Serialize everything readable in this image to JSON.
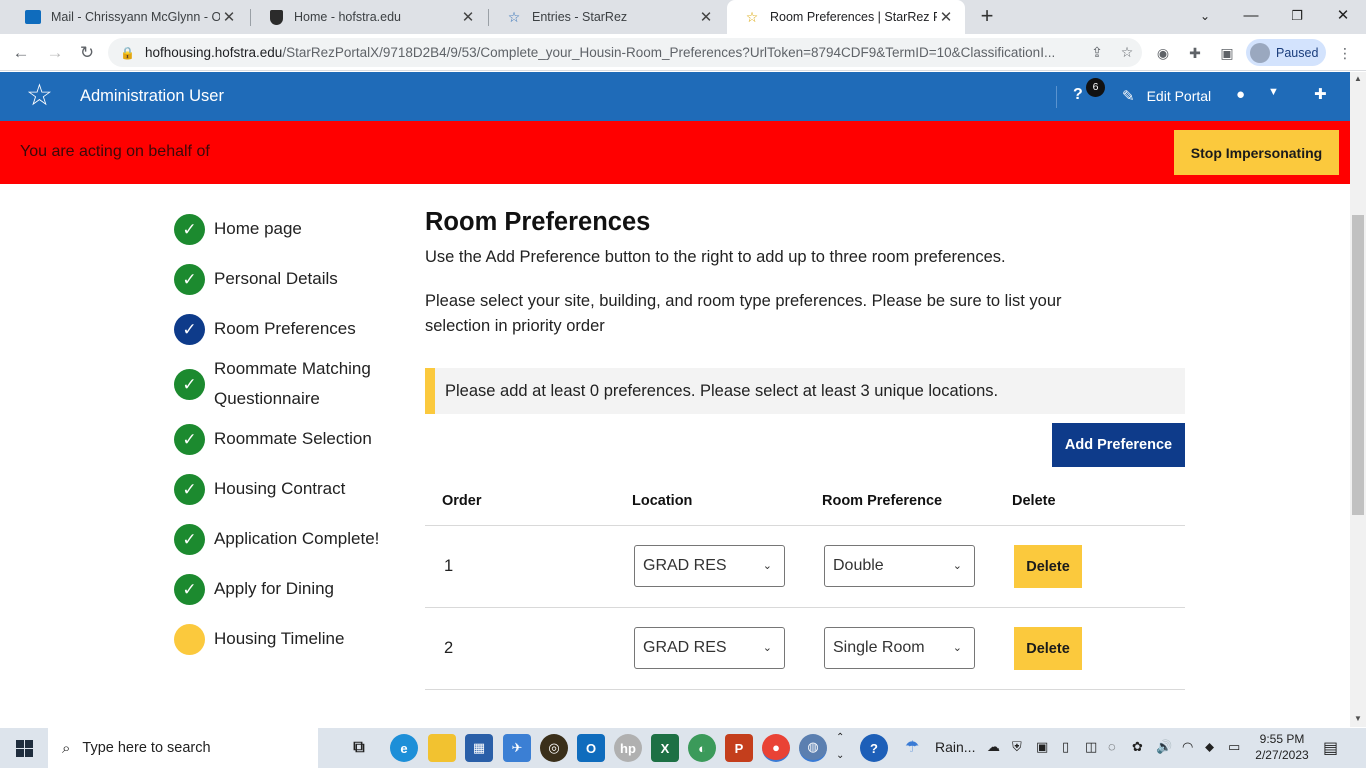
{
  "browser": {
    "tabs": [
      {
        "title": "Mail - Chrissyann McGlynn - Outl",
        "icon": "outlook-icon"
      },
      {
        "title": "Home - hofstra.edu",
        "icon": "hofstra-shield-icon"
      },
      {
        "title": "Entries - StarRez",
        "icon": "starrez-star-icon"
      },
      {
        "title": "Room Preferences | StarRez Porta",
        "icon": "starrez-star-icon"
      }
    ],
    "url_host": "hofhousing.hofstra.edu",
    "url_path": "/StarRezPortalX/9718D2B4/9/53/Complete_your_Housin-Room_Preferences?UrlToken=8794CDF9&TermID=10&ClassificationI...",
    "profile_label": "Paused"
  },
  "portal": {
    "user_name": "Administration User",
    "help_badge": "6",
    "edit_portal": "Edit Portal",
    "impersonation_text": "You are acting on behalf of",
    "stop_impersonating": "Stop Impersonating"
  },
  "steps": [
    {
      "label": "Home page",
      "status": "done"
    },
    {
      "label": "Personal Details",
      "status": "done"
    },
    {
      "label": "Room Preferences",
      "status": "current"
    },
    {
      "label": "Roommate Matching Questionnaire",
      "status": "done"
    },
    {
      "label": "Roommate Selection",
      "status": "done"
    },
    {
      "label": "Housing Contract",
      "status": "done"
    },
    {
      "label": "Application Complete!",
      "status": "done"
    },
    {
      "label": "Apply for Dining",
      "status": "done"
    },
    {
      "label": "Housing Timeline",
      "status": "pending"
    }
  ],
  "main": {
    "title": "Room Preferences",
    "intro1": "Use the Add Preference button to the right to add up to three room preferences.",
    "intro2": "Please select your site, building, and room type preferences. Please be sure to list your selection in priority order",
    "notice": "Please add at least 0 preferences. Please select at least 3 unique locations.",
    "add_button": "Add Preference",
    "columns": [
      "Order",
      "Location",
      "Room Preference",
      "Delete"
    ],
    "rows": [
      {
        "order": "1",
        "location": "GRAD RES",
        "room": "Double",
        "delete": "Delete"
      },
      {
        "order": "2",
        "location": "GRAD RES",
        "room": "Single Room",
        "delete": "Delete"
      }
    ]
  },
  "taskbar": {
    "search_placeholder": "Type here to search",
    "weather": "Rain...",
    "time": "9:55 PM",
    "date": "2/27/2023"
  },
  "colors": {
    "header_blue": "#1f6bb8",
    "impersonation_red": "#ff0000",
    "accent_yellow": "#fbc93d",
    "navy": "#0e3b8a",
    "done_green": "#1c8a2f"
  }
}
